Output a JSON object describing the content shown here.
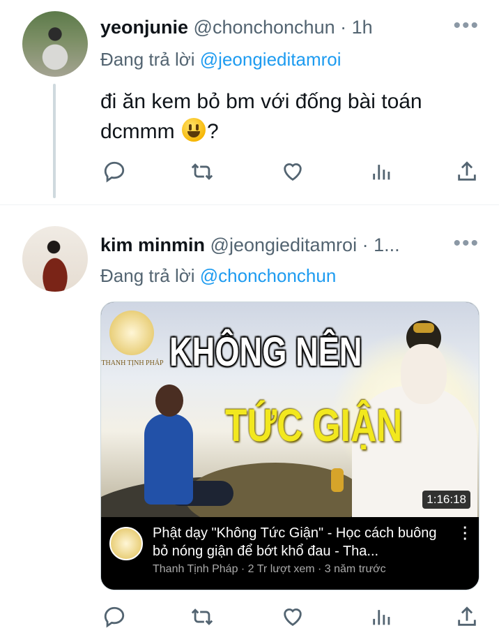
{
  "tweets": [
    {
      "name": "yeonjunie",
      "handle": "@chonchonchun",
      "time": "· 1h",
      "replying_prefix": "Đang trả lời ",
      "replying_to": "@jeongieditamroi",
      "text_part1": "đi ăn kem bỏ bm với đống bài toán dcmmm ",
      "text_emoji": "grinning-face-emoji",
      "text_part2": "?"
    },
    {
      "name": "kim minmin",
      "handle": "@jeongieditamroi",
      "time": "· 1...",
      "replying_prefix": "Đang trả lời ",
      "replying_to": "@chonchonchun",
      "video": {
        "overlay_title_line1": "KHÔNG NÊN",
        "overlay_title_line2": "TỨC GIẬN",
        "logo_text": "THANH TỊNH PHÁP",
        "duration": "1:16:18",
        "title": "Phật dạy \"Không Tức Giận\" - Học cách buông bỏ nóng giận để bớt khổ đau - Tha...",
        "meta": "Thanh Tịnh Pháp · 2 Tr lượt xem · 3 năm trước"
      }
    }
  ],
  "icons": {
    "more": "more-horizontal-icon",
    "reply": "reply-icon",
    "retweet": "retweet-icon",
    "like": "heart-icon",
    "views": "analytics-icon",
    "share": "share-icon"
  },
  "colors": {
    "link": "#1d9bf0",
    "secondary_text": "#536471",
    "icon": "#536471",
    "video_overlay_yellow": "#f2e81e"
  }
}
